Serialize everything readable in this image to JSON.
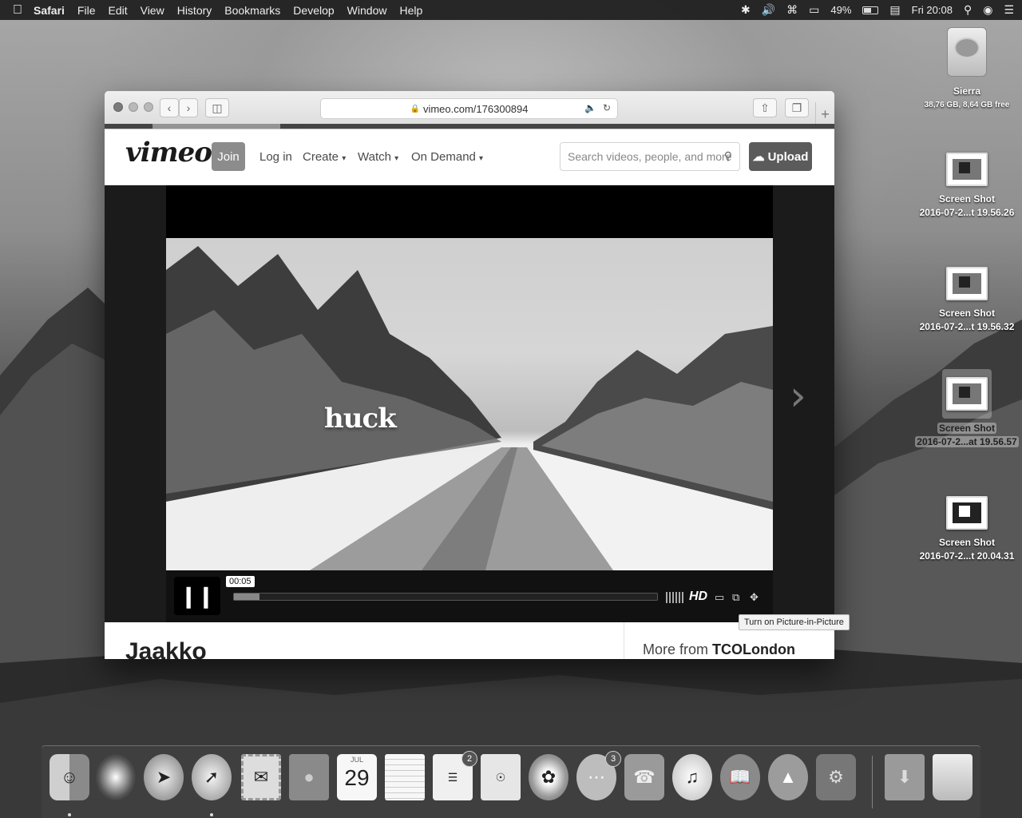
{
  "menubar": {
    "app": "Safari",
    "items": [
      "File",
      "Edit",
      "View",
      "History",
      "Bookmarks",
      "Develop",
      "Window",
      "Help"
    ],
    "battery_percent": "49%",
    "clock": "Fri 20:08"
  },
  "desktop": {
    "drive": {
      "name": "Sierra",
      "detail": "38,76 GB, 8,64 GB free"
    },
    "files": [
      {
        "name": "Screen Shot",
        "detail": "2016-07-2...t 19.56.26"
      },
      {
        "name": "Screen Shot",
        "detail": "2016-07-2...t 19.56.32"
      },
      {
        "name": "Screen Shot",
        "detail": "2016-07-2...at 19.56.57"
      },
      {
        "name": "Screen Shot",
        "detail": "2016-07-2...t 20.04.31"
      }
    ]
  },
  "browser": {
    "url": "vimeo.com/176300894"
  },
  "vimeo": {
    "logo": "vimeo",
    "join": "Join",
    "login": "Log in",
    "create": "Create",
    "watch": "Watch",
    "on_demand": "On Demand",
    "search_placeholder": "Search videos, people, and more",
    "upload": "Upload"
  },
  "player": {
    "overlay_text": "huck",
    "current_time": "00:05",
    "progress_fraction": 0.06,
    "buffered_fraction": 0.03,
    "hd": "HD",
    "tooltip": "Turn on Picture-in-Picture"
  },
  "page": {
    "video_title_partial": "Jaakko",
    "more_from_label": "More from",
    "more_from_user": "TCOLondon"
  },
  "dock": {
    "calendar_month": "JUL",
    "calendar_day": "29",
    "reminders_badge": "2",
    "messages_badge": "3"
  }
}
